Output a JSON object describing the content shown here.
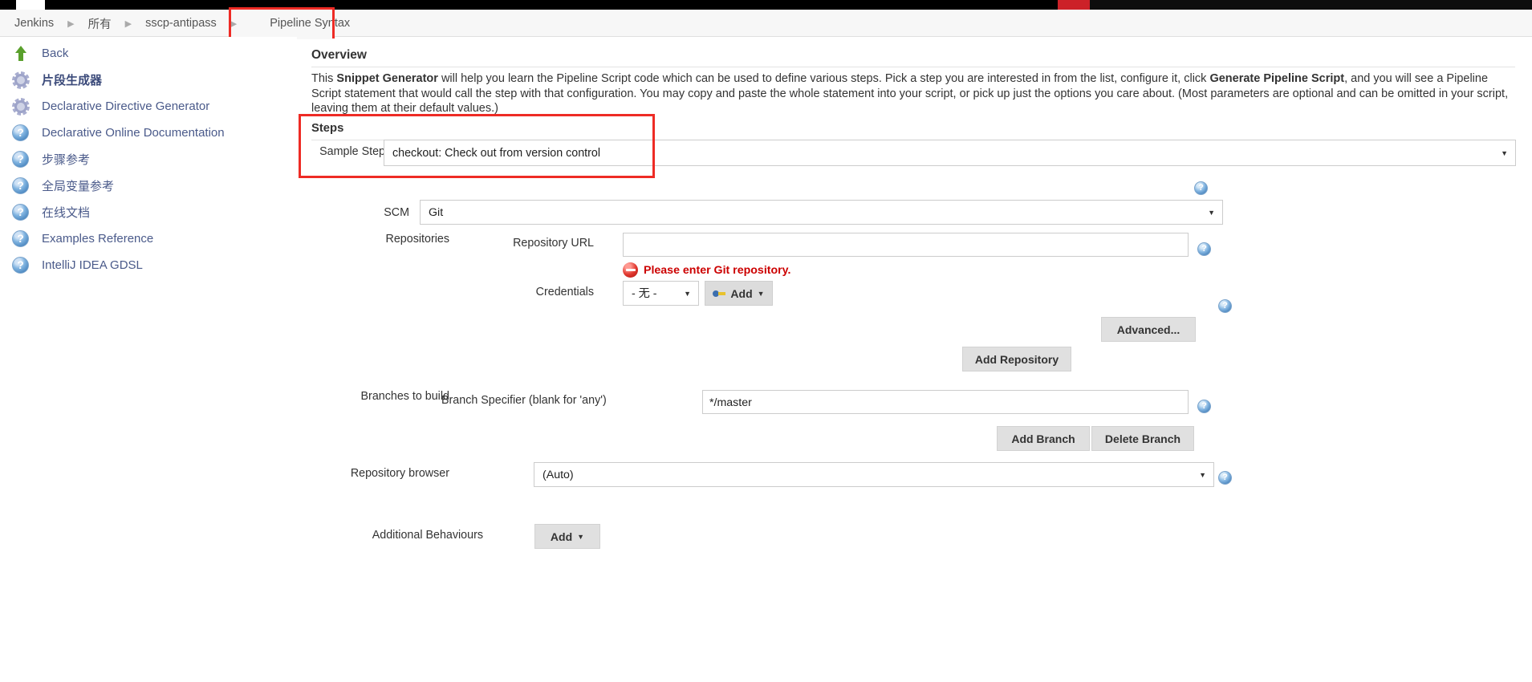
{
  "window": {
    "accent_red": "#cc2128",
    "highlight_red": "#ee2b25",
    "error_red": "#cc0000"
  },
  "breadcrumb": {
    "items": [
      "Jenkins",
      "所有",
      "sscp-antipass"
    ],
    "current": "Pipeline Syntax"
  },
  "sidebar": {
    "items": [
      {
        "label": "Back",
        "icon": "up-arrow-icon",
        "bold": false
      },
      {
        "label": "片段生成器",
        "icon": "gear-icon",
        "bold": true
      },
      {
        "label": "Declarative Directive Generator",
        "icon": "gear-icon",
        "bold": false
      },
      {
        "label": "Declarative Online Documentation",
        "icon": "help-icon",
        "bold": false
      },
      {
        "label": "步骤参考",
        "icon": "help-icon",
        "bold": false
      },
      {
        "label": "全局变量参考",
        "icon": "help-icon",
        "bold": false
      },
      {
        "label": "在线文档",
        "icon": "help-icon",
        "bold": false
      },
      {
        "label": "Examples Reference",
        "icon": "help-icon",
        "bold": false
      },
      {
        "label": "IntelliJ IDEA GDSL",
        "icon": "help-icon",
        "bold": false
      }
    ]
  },
  "main": {
    "overview_title": "Overview",
    "overview_paragraph_part1": "This ",
    "overview_bold1": "Snippet Generator",
    "overview_paragraph_part2": " will help you learn the Pipeline Script code which can be used to define various steps. Pick a step you are interested in from the list, configure it, click ",
    "overview_bold2": "Generate Pipeline Script",
    "overview_paragraph_part3": ", and you will see a Pipeline Script statement that would call the step with that configuration. You may copy and paste the whole statement into your script, or pick up just the options you care about. (Most parameters are optional and can be omitted in your script, leaving them at their default values.)",
    "steps": {
      "title": "Steps",
      "sample_step_label": "Sample Step",
      "sample_step_value": "checkout: Check out from version control"
    },
    "scm": {
      "label": "SCM",
      "value": "Git"
    },
    "repositories": {
      "label": "Repositories",
      "url_label": "Repository URL",
      "url_value": "",
      "url_error": "Please enter Git repository.",
      "credentials_label": "Credentials",
      "credentials_value": "- 无 -",
      "add_credentials_label": "Add",
      "advanced_label": "Advanced...",
      "add_repository_label": "Add Repository"
    },
    "branches": {
      "label": "Branches to build",
      "specifier_label": "Branch Specifier (blank for 'any')",
      "specifier_value": "*/master",
      "add_branch_label": "Add Branch",
      "delete_branch_label": "Delete Branch"
    },
    "repository_browser": {
      "label": "Repository browser",
      "value": "(Auto)"
    },
    "additional_behaviours": {
      "label": "Additional Behaviours",
      "add_label": "Add"
    }
  }
}
